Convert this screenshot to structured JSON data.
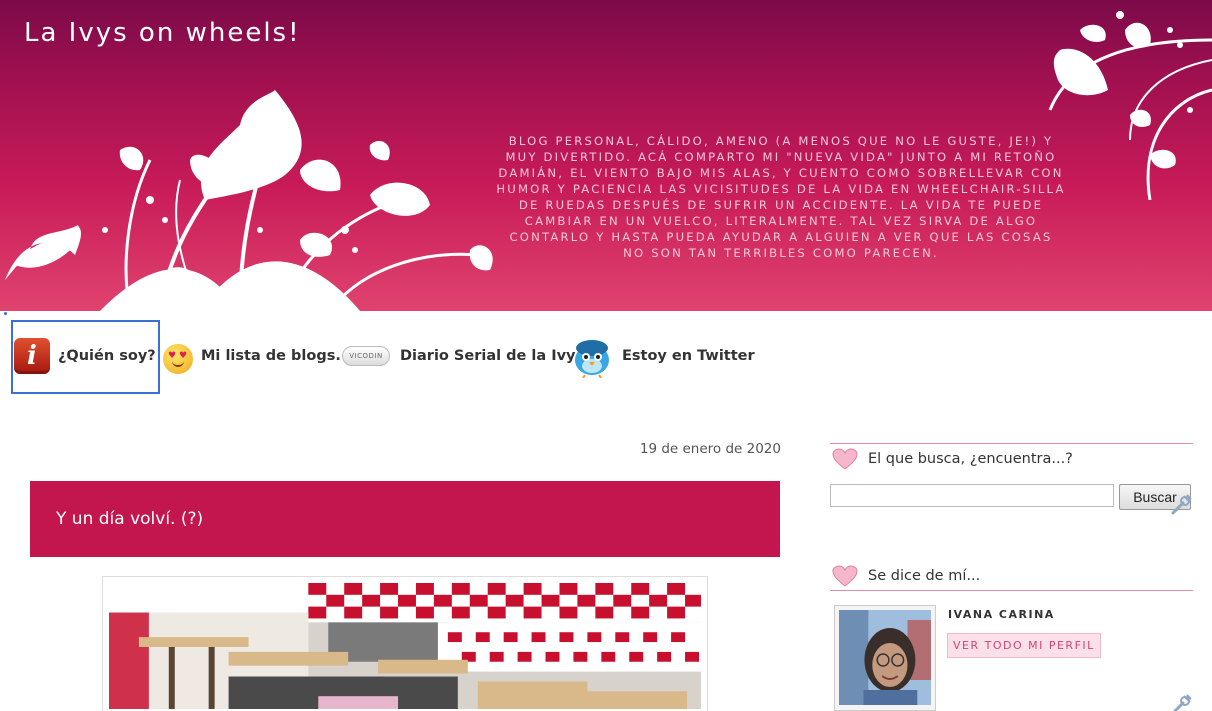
{
  "header": {
    "title": "La Ivys on wheels!",
    "description": "Blog personal, cálido, ameno (a menos que no le guste, je!) y muy divertido. Acá comparto mi \"nueva vida\" junto a mi retoño Damián, el viento bajo mis alas, y cuento como sobrellevar con humor y paciencia las vicisitudes de la vida en wheelchair-silla de ruedas después de sufrir un accidente. La vida te puede cambiar en un vuelco, literalmente. Tal vez sirva de algo contarlo y hasta pueda ayudar a alguien a ver que las cosas no son tan terribles como parecen."
  },
  "nav": {
    "items": [
      {
        "label": "¿Quién soy?",
        "icon": "info-icon"
      },
      {
        "label": "Mi lista de blogs.",
        "icon": "heart-eyes-smiley-icon"
      },
      {
        "label": "Diario Serial de la Ivy",
        "icon": "badge-icon",
        "icon_text": "VICODIN"
      },
      {
        "label": "Estoy en Twitter",
        "icon": "twitter-bird-icon"
      }
    ]
  },
  "post": {
    "date": "19 de enero de 2020",
    "title": "Y un día volví. (?)"
  },
  "sidebar": {
    "search_widget": {
      "title": "El que busca, ¿encuentra...?",
      "button_label": "Buscar"
    },
    "profile_widget": {
      "title": "Se dice de mí...",
      "name": "IVANA CARINA",
      "link_label": "VER TODO MI PERFIL"
    }
  },
  "colors": {
    "header_top": "#7c0a4a",
    "header_bottom": "#e0436f",
    "post_header": "#c3164f",
    "focus_ring": "#3a6fd8",
    "widget_border": "#e58aa8"
  }
}
